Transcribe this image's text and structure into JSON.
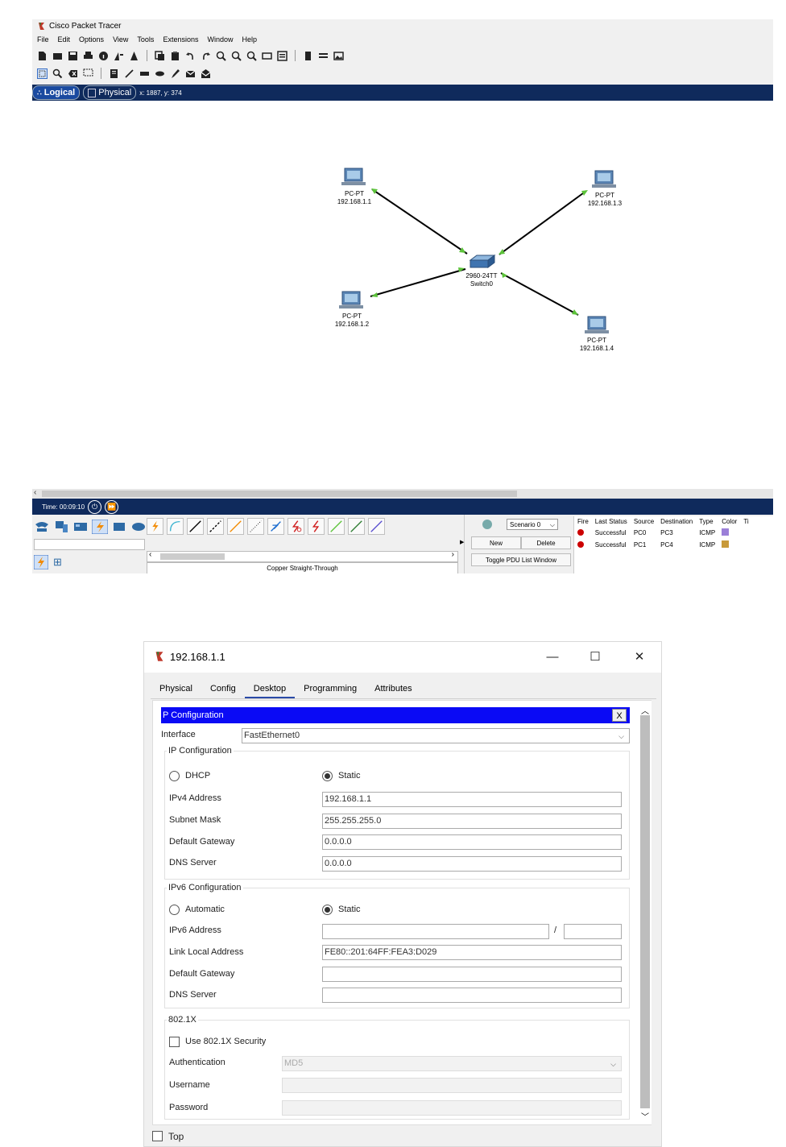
{
  "packet_tracer": {
    "app_title": "Cisco Packet Tracer",
    "menu": [
      "File",
      "Edit",
      "Options",
      "View",
      "Tools",
      "Extensions",
      "Window",
      "Help"
    ],
    "view_tabs": {
      "logical": "Logical",
      "physical": "Physical"
    },
    "coordinates": "x: 1887, y: 374",
    "topology": {
      "pc1": {
        "model": "PC-PT",
        "ip": "192.168.1.1"
      },
      "pc2": {
        "model": "PC-PT",
        "ip": "192.168.1.2"
      },
      "pc3": {
        "model": "PC-PT",
        "ip": "192.168.1.3"
      },
      "pc4": {
        "model": "PC-PT",
        "ip": "192.168.1.4"
      },
      "switch": {
        "model": "2960-24TT",
        "name": "Switch0"
      }
    },
    "time": "Time: 00:09:10",
    "connection_name": "Copper Straight-Through",
    "scenario": {
      "select": "Scenario 0",
      "new": "New",
      "delete": "Delete",
      "toggle": "Toggle PDU List Window"
    },
    "pdu_list": {
      "headers": [
        "Fire",
        "Last Status",
        "Source",
        "Destination",
        "Type",
        "Color",
        "Ti"
      ],
      "rows": [
        {
          "status": "Successful",
          "source": "PC0",
          "destination": "PC3",
          "type": "ICMP",
          "color": "#9b7fd8"
        },
        {
          "status": "Successful",
          "source": "PC1",
          "destination": "PC4",
          "type": "ICMP",
          "color": "#c89a3a"
        }
      ]
    }
  },
  "dialog": {
    "title": "192.168.1.1",
    "tabs": [
      "Physical",
      "Config",
      "Desktop",
      "Programming",
      "Attributes"
    ],
    "active_tab": "Desktop",
    "panel_title": "P Configuration",
    "close_x": "X",
    "interface_label": "Interface",
    "interface_value": "FastEthernet0",
    "ipv4": {
      "group_label": "IP Configuration",
      "dhcp": "DHCP",
      "static": "Static",
      "address_label": "IPv4 Address",
      "address": "192.168.1.1",
      "mask_label": "Subnet Mask",
      "mask": "255.255.255.0",
      "gateway_label": "Default Gateway",
      "gateway": "0.0.0.0",
      "dns_label": "DNS Server",
      "dns": "0.0.0.0"
    },
    "ipv6": {
      "group_label": "IPv6 Configuration",
      "automatic": "Automatic",
      "static": "Static",
      "address_label": "IPv6 Address",
      "address": "",
      "prefix": "",
      "slash": "/",
      "link_local_label": "Link Local Address",
      "link_local": "FE80::201:64FF:FEA3:D029",
      "gateway_label": "Default Gateway",
      "gateway": "",
      "dns_label": "DNS Server",
      "dns": ""
    },
    "dot1x": {
      "group_label": "802.1X",
      "use_label": "Use 802.1X Security",
      "auth_label": "Authentication",
      "auth_value": "MD5",
      "username_label": "Username",
      "password_label": "Password"
    },
    "top_label": "Top"
  }
}
